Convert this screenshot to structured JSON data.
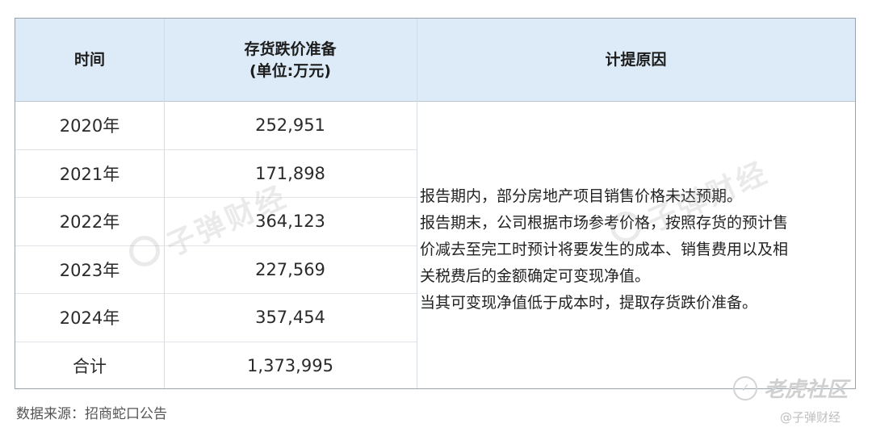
{
  "table": {
    "headers": [
      "时间",
      "存货跌价准备\n(单位:万元)",
      "计提原因"
    ],
    "rows": [
      {
        "year": "2020年",
        "value": "252,951"
      },
      {
        "year": "2021年",
        "value": "171,898"
      },
      {
        "year": "2022年",
        "value": "364,123"
      },
      {
        "year": "2023年",
        "value": "227,569"
      },
      {
        "year": "2024年",
        "value": "357,454"
      },
      {
        "year": "合计",
        "value": "1,373,995"
      }
    ],
    "reason_lines": [
      "报告期内，部分房地产项目销售价格未达预期。",
      "报告期末，公司根据市场参考价格，按照存货的预计售",
      "价减去至完工时预计将要发生的成本、销售费用以及相",
      "关税费后的金额确定可变现净值。",
      "当其可变现净值低于成本时，提取存货跌价准备。"
    ]
  },
  "source": "数据来源：招商蛇口公告",
  "watermark": "子弹财经",
  "tiger_brand": "老虎社区",
  "credit": "@子弹财经"
}
